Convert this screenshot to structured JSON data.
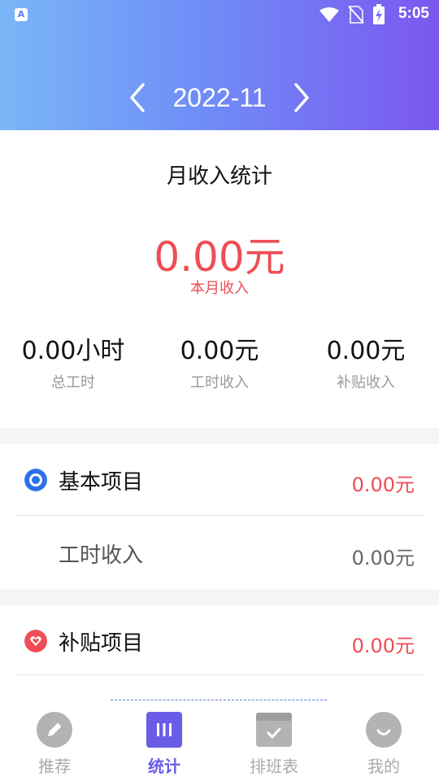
{
  "status_bar": {
    "time": "5:05",
    "app_badge": "A"
  },
  "header": {
    "month": "2022-11"
  },
  "summary": {
    "title": "月收入统计",
    "amount": "0.00元",
    "amount_label": "本月收入",
    "stats": [
      {
        "value": "0.00小时",
        "label": "总工时"
      },
      {
        "value": "0.00元",
        "label": "工时收入"
      },
      {
        "value": "0.00元",
        "label": "补贴收入"
      }
    ]
  },
  "sections": {
    "basic": {
      "name": "基本项目",
      "value": "0.00元"
    },
    "basic_item": {
      "name": "工时收入",
      "value": "0.00元"
    },
    "subsidy": {
      "name": "补贴项目",
      "value": "0.00元"
    }
  },
  "tabs": [
    {
      "label": "推荐",
      "icon": "pencil-icon"
    },
    {
      "label": "统计",
      "icon": "stats-icon"
    },
    {
      "label": "排班表",
      "icon": "calendar-icon"
    },
    {
      "label": "我的",
      "icon": "smile-icon"
    }
  ],
  "colors": {
    "accent_red": "#ee4d55",
    "active_tab": "#6a5ce6",
    "basic_icon": "#2f6fe8",
    "subsidy_icon": "#ee4d55"
  }
}
